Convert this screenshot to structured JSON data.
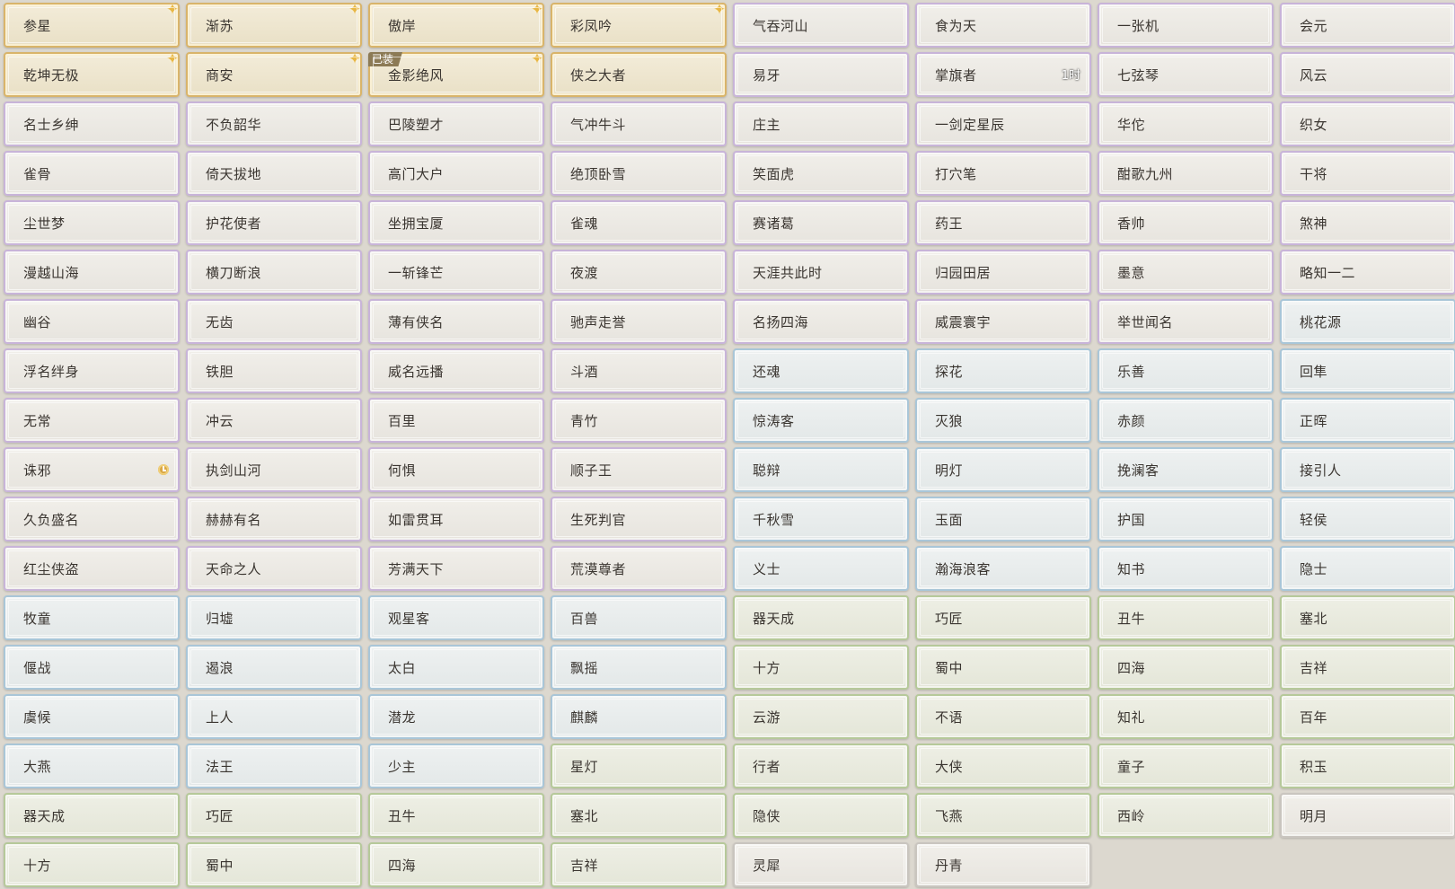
{
  "titles": [
    {
      "name": "参星",
      "style": "gold",
      "star": true
    },
    {
      "name": "渐苏",
      "style": "gold",
      "star": true
    },
    {
      "name": "傲岸",
      "style": "gold",
      "star": true
    },
    {
      "name": "彩凤吟",
      "style": "gold",
      "star": true
    },
    {
      "name": "气吞河山",
      "style": "purple"
    },
    {
      "name": "食为天",
      "style": "purple"
    },
    {
      "name": "一张机",
      "style": "purple"
    },
    {
      "name": "会元",
      "style": "purple"
    },
    {
      "name": "乾坤无极",
      "style": "gold",
      "star": true
    },
    {
      "name": "商安",
      "style": "gold",
      "star": true
    },
    {
      "name": "金影绝风",
      "style": "gold",
      "star": true,
      "badge": "已装"
    },
    {
      "name": "侠之大者",
      "style": "gold"
    },
    {
      "name": "易牙",
      "style": "purple"
    },
    {
      "name": "掌旗者",
      "style": "purple",
      "timer": "1时"
    },
    {
      "name": "七弦琴",
      "style": "purple"
    },
    {
      "name": "风云",
      "style": "purple"
    },
    {
      "name": "名士乡绅",
      "style": "purple"
    },
    {
      "name": "不负韶华",
      "style": "purple"
    },
    {
      "name": "巴陵塑才",
      "style": "purple"
    },
    {
      "name": "气冲牛斗",
      "style": "purple"
    },
    {
      "name": "庄主",
      "style": "purple"
    },
    {
      "name": "一剑定星辰",
      "style": "purple"
    },
    {
      "name": "华佗",
      "style": "purple"
    },
    {
      "name": "织女",
      "style": "purple"
    },
    {
      "name": "雀骨",
      "style": "purple"
    },
    {
      "name": "倚天拔地",
      "style": "purple"
    },
    {
      "name": "高门大户",
      "style": "purple"
    },
    {
      "name": "绝顶卧雪",
      "style": "purple"
    },
    {
      "name": "笑面虎",
      "style": "purple"
    },
    {
      "name": "打穴笔",
      "style": "purple"
    },
    {
      "name": "酣歌九州",
      "style": "purple"
    },
    {
      "name": "干将",
      "style": "purple"
    },
    {
      "name": "尘世梦",
      "style": "purple"
    },
    {
      "name": "护花使者",
      "style": "purple"
    },
    {
      "name": "坐拥宝厦",
      "style": "purple"
    },
    {
      "name": "雀魂",
      "style": "purple"
    },
    {
      "name": "赛诸葛",
      "style": "purple"
    },
    {
      "name": "药王",
      "style": "purple"
    },
    {
      "name": "香帅",
      "style": "purple"
    },
    {
      "name": "煞神",
      "style": "purple"
    },
    {
      "name": "漫越山海",
      "style": "purple"
    },
    {
      "name": "横刀断浪",
      "style": "purple"
    },
    {
      "name": "一斩锋芒",
      "style": "purple"
    },
    {
      "name": "夜渡",
      "style": "purple"
    },
    {
      "name": "天涯共此时",
      "style": "purple"
    },
    {
      "name": "归园田居",
      "style": "purple"
    },
    {
      "name": "墨意",
      "style": "purple"
    },
    {
      "name": "略知一二",
      "style": "purple"
    },
    {
      "name": "幽谷",
      "style": "purple"
    },
    {
      "name": "无齿",
      "style": "purple"
    },
    {
      "name": "薄有侠名",
      "style": "purple"
    },
    {
      "name": "驰声走誉",
      "style": "purple"
    },
    {
      "name": "名扬四海",
      "style": "purple"
    },
    {
      "name": "威震寰宇",
      "style": "purple"
    },
    {
      "name": "举世闻名",
      "style": "purple"
    },
    {
      "name": "桃花源",
      "style": "blue"
    },
    {
      "name": "浮名绊身",
      "style": "purple"
    },
    {
      "name": "铁胆",
      "style": "purple"
    },
    {
      "name": "威名远播",
      "style": "purple"
    },
    {
      "name": "斗酒",
      "style": "purple"
    },
    {
      "name": "还魂",
      "style": "blue"
    },
    {
      "name": "探花",
      "style": "blue"
    },
    {
      "name": "乐善",
      "style": "blue"
    },
    {
      "name": "回隼",
      "style": "blue"
    },
    {
      "name": "无常",
      "style": "purple"
    },
    {
      "name": "冲云",
      "style": "purple"
    },
    {
      "name": "百里",
      "style": "purple"
    },
    {
      "name": "青竹",
      "style": "purple"
    },
    {
      "name": "惊涛客",
      "style": "blue"
    },
    {
      "name": "灭狼",
      "style": "blue"
    },
    {
      "name": "赤颜",
      "style": "blue"
    },
    {
      "name": "正晖",
      "style": "blue"
    },
    {
      "name": "诛邪",
      "style": "purple",
      "clock": true
    },
    {
      "name": "执剑山河",
      "style": "purple"
    },
    {
      "name": "何惧",
      "style": "purple"
    },
    {
      "name": "顺子王",
      "style": "purple"
    },
    {
      "name": "聪辩",
      "style": "blue"
    },
    {
      "name": "明灯",
      "style": "blue"
    },
    {
      "name": "挽澜客",
      "style": "blue"
    },
    {
      "name": "接引人",
      "style": "blue"
    },
    {
      "name": "久负盛名",
      "style": "purple"
    },
    {
      "name": "赫赫有名",
      "style": "purple"
    },
    {
      "name": "如雷贯耳",
      "style": "purple"
    },
    {
      "name": "生死判官",
      "style": "purple"
    },
    {
      "name": "千秋雪",
      "style": "blue"
    },
    {
      "name": "玉面",
      "style": "blue"
    },
    {
      "name": "护国",
      "style": "blue"
    },
    {
      "name": "轻侯",
      "style": "blue"
    },
    {
      "name": "红尘侠盗",
      "style": "purple"
    },
    {
      "name": "天命之人",
      "style": "purple"
    },
    {
      "name": "芳满天下",
      "style": "purple"
    },
    {
      "name": "荒漠尊者",
      "style": "purple"
    },
    {
      "name": "义士",
      "style": "blue"
    },
    {
      "name": "瀚海浪客",
      "style": "blue"
    },
    {
      "name": "知书",
      "style": "blue"
    },
    {
      "name": "隐士",
      "style": "blue"
    },
    {
      "name": "牧童",
      "style": "blue"
    },
    {
      "name": "归墟",
      "style": "blue"
    },
    {
      "name": "观星客",
      "style": "blue"
    },
    {
      "name": "百兽",
      "style": "blue"
    },
    {
      "name": "器天成",
      "style": "green"
    },
    {
      "name": "巧匠",
      "style": "green"
    },
    {
      "name": "丑牛",
      "style": "green"
    },
    {
      "name": "塞北",
      "style": "green"
    },
    {
      "name": "偃战",
      "style": "blue"
    },
    {
      "name": "遏浪",
      "style": "blue"
    },
    {
      "name": "太白",
      "style": "blue"
    },
    {
      "name": "飘摇",
      "style": "blue"
    },
    {
      "name": "十方",
      "style": "green"
    },
    {
      "name": "蜀中",
      "style": "green"
    },
    {
      "name": "四海",
      "style": "green"
    },
    {
      "name": "吉祥",
      "style": "green"
    },
    {
      "name": "虞候",
      "style": "blue"
    },
    {
      "name": "上人",
      "style": "blue"
    },
    {
      "name": "潜龙",
      "style": "blue"
    },
    {
      "name": "麒麟",
      "style": "blue"
    },
    {
      "name": "云游",
      "style": "green"
    },
    {
      "name": "不语",
      "style": "green"
    },
    {
      "name": "知礼",
      "style": "green"
    },
    {
      "name": "百年",
      "style": "green"
    },
    {
      "name": "大燕",
      "style": "blue"
    },
    {
      "name": "法王",
      "style": "blue"
    },
    {
      "name": "少主",
      "style": "blue"
    },
    {
      "name": "星灯",
      "style": "green"
    },
    {
      "name": "行者",
      "style": "green"
    },
    {
      "name": "大侠",
      "style": "green"
    },
    {
      "name": "童子",
      "style": "green"
    },
    {
      "name": "积玉",
      "style": "green"
    },
    {
      "name": "器天成",
      "style": "green"
    },
    {
      "name": "巧匠",
      "style": "green"
    },
    {
      "name": "丑牛",
      "style": "green"
    },
    {
      "name": "塞北",
      "style": "green"
    },
    {
      "name": "隐侠",
      "style": "green"
    },
    {
      "name": "飞燕",
      "style": "green"
    },
    {
      "name": "西岭",
      "style": "green"
    },
    {
      "name": "明月",
      "style": "plain"
    },
    {
      "name": "十方",
      "style": "green"
    },
    {
      "name": "蜀中",
      "style": "green"
    },
    {
      "name": "四海",
      "style": "green"
    },
    {
      "name": "吉祥",
      "style": "green"
    },
    {
      "name": "灵犀",
      "style": "plain"
    },
    {
      "name": "丹青",
      "style": "plain"
    }
  ],
  "icons": {
    "star": "star-icon",
    "clock": "clock-icon"
  },
  "colors": {
    "gold": "#d9b46a",
    "purple": "#c8b4d9",
    "blue": "#a9c6d8",
    "green": "#b6c99a",
    "plain": "#c9c5bf",
    "text": "#3a3530"
  }
}
